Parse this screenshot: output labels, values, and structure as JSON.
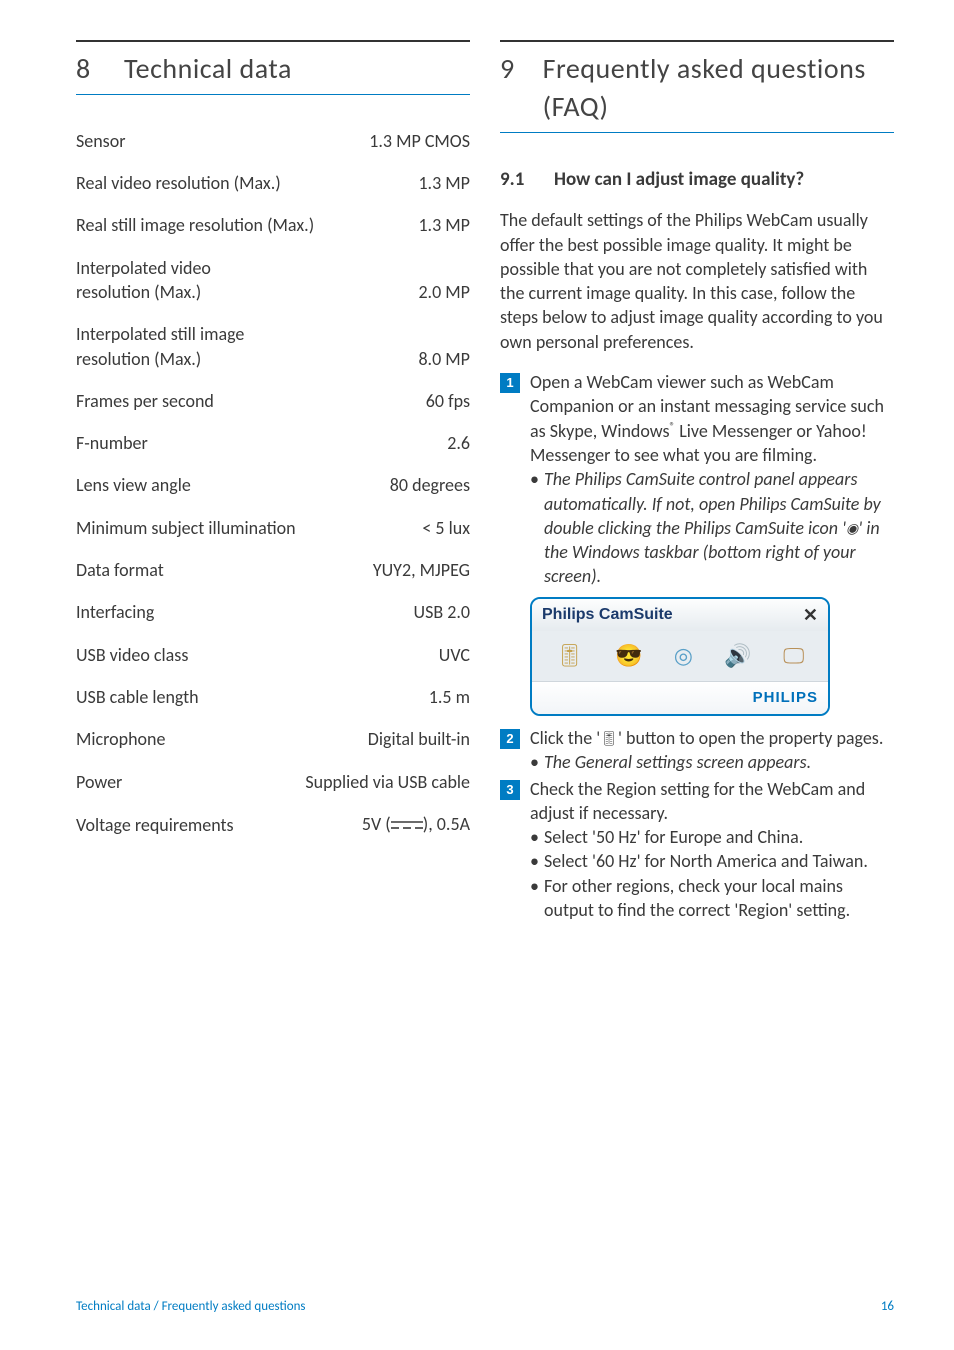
{
  "left": {
    "section_num": "8",
    "section_title": "Technical data",
    "specs": [
      {
        "label": "Sensor",
        "value": "1.3 MP CMOS"
      },
      {
        "label": "Real video resolution (Max.)",
        "value": "1.3 MP"
      },
      {
        "label": "Real still image resolution (Max.)",
        "value": "1.3 MP"
      },
      {
        "label": "Interpolated video\nresolution (Max.)",
        "value": "2.0 MP"
      },
      {
        "label": "Interpolated still image\nresolution (Max.)",
        "value": "8.0 MP"
      },
      {
        "label": "Frames per second",
        "value": "60 fps"
      },
      {
        "label": "F-number",
        "value": "2.6"
      },
      {
        "label": "Lens view angle",
        "value": "80 degrees"
      },
      {
        "label": "Minimum subject illumination",
        "value": "< 5 lux"
      },
      {
        "label": "Data format",
        "value": "YUY2, MJPEG"
      },
      {
        "label": "Interfacing",
        "value": "USB 2.0"
      },
      {
        "label": "USB video class",
        "value": "UVC"
      },
      {
        "label": "USB cable length",
        "value": "1.5 m"
      },
      {
        "label": "Microphone",
        "value": "Digital built-in"
      },
      {
        "label": "Power",
        "value": "Supplied via USB cable"
      }
    ],
    "voltage_label": "Voltage requirements",
    "voltage_prefix": "5V (",
    "voltage_suffix": "), 0.5A"
  },
  "right": {
    "section_num": "9",
    "section_title": "Frequently asked questions (FAQ)",
    "sub_num": "9.1",
    "sub_title": "How can I adjust image quality?",
    "intro": "The default settings of the Philips WebCam usually offer the best possible image quality. It might be possible that you are not completely satisfied with the current image quality. In this case, follow the steps below to adjust image quality according to you own personal preferences.",
    "step1_a": "Open a WebCam viewer such as WebCam Companion or an instant messaging service such as Skype,  Windows",
    "step1_b": " Live Messenger or Yahoo! Messenger to see what you are filming.",
    "step1_note_a": "The Philips CamSuite control panel appears automatically. If not, open Philips CamSuite by double clicking the Philips CamSuite icon '",
    "step1_note_b": "' in the Windows taskbar (bottom right of your screen).",
    "camsuite_title": "Philips CamSuite",
    "camsuite_brand": "PHILIPS",
    "step2_a": "Click the '",
    "step2_b": "' button to open the property pages.",
    "step2_note": "The General settings screen appears.",
    "step3": "Check the Region setting for the WebCam and adjust if necessary.",
    "step3_b1": "Select '50 Hz' for Europe and China.",
    "step3_b2": "Select '60 Hz' for North America and Taiwan.",
    "step3_b3": "For other regions, check your local mains output to find the correct 'Region' setting."
  },
  "footer": {
    "left": "Technical data / Frequently asked questions",
    "right": "16"
  }
}
